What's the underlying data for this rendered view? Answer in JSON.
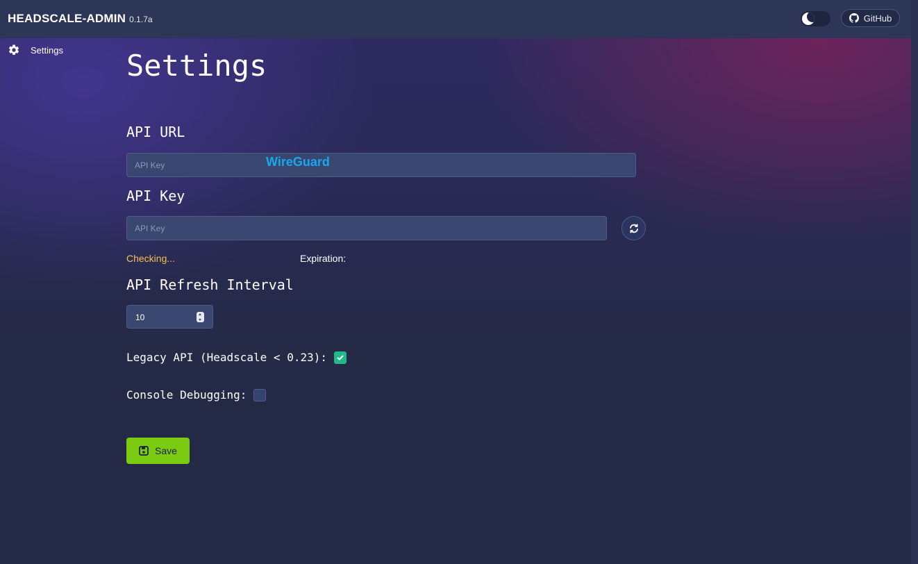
{
  "header": {
    "title": "HEADSCALE-ADMIN",
    "version": "0.1.7a",
    "github_label": "GitHub"
  },
  "sidebar": {
    "items": [
      {
        "label": "Settings",
        "icon": "gear-icon"
      }
    ]
  },
  "main": {
    "page_title": "Settings",
    "api_url": {
      "label": "API URL",
      "placeholder": "API Key",
      "value": "",
      "overlay_text": "WireGuard"
    },
    "api_key": {
      "label": "API Key",
      "placeholder": "API Key",
      "value": "",
      "refresh_icon": "refresh-icon",
      "status": "Checking...",
      "expiration_label": "Expiration:"
    },
    "refresh_interval": {
      "label": "API Refresh Interval",
      "value": "10"
    },
    "legacy_api": {
      "label": "Legacy API (Headscale < 0.23):",
      "checked": true
    },
    "console_debugging": {
      "label": "Console Debugging:",
      "checked": false
    },
    "save_label": "Save"
  },
  "colors": {
    "accent_save": "#7acb12",
    "checkbox_checked": "#21b88a",
    "status_checking": "#f3c34b",
    "overlay_text": "#1aa7f0"
  }
}
